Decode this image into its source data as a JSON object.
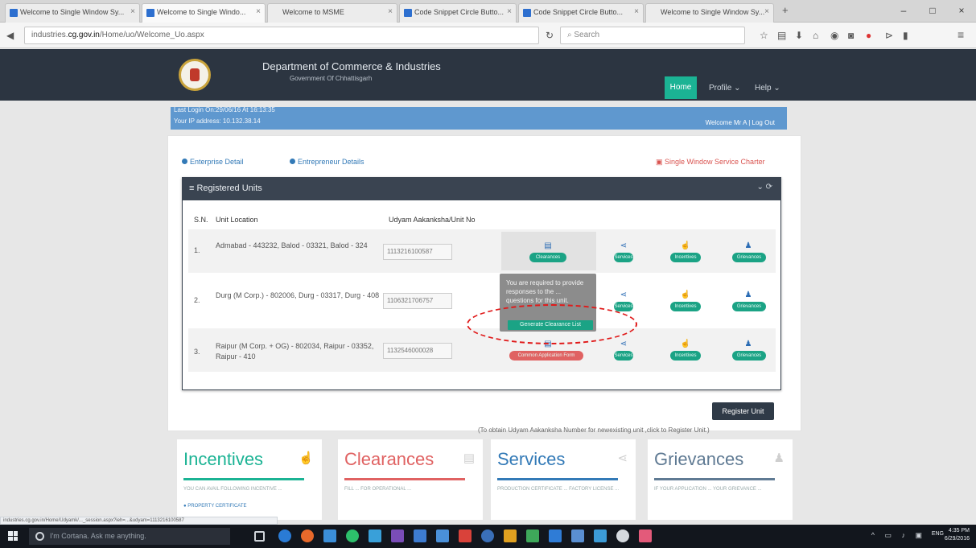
{
  "browser": {
    "tabs": [
      {
        "title": "Welcome to Single Window Sy...",
        "active": false
      },
      {
        "title": "Welcome to Single Windo...",
        "active": true
      },
      {
        "title": "Welcome to MSME",
        "active": false
      },
      {
        "title": "Code Snippet Circle Butto...",
        "active": false
      },
      {
        "title": "Code Snippet Circle Butto...",
        "active": false
      },
      {
        "title": "Welcome to Single Window Sy...",
        "active": false
      }
    ],
    "url_prefix": "industries.",
    "url_domain": "cg.gov.in",
    "url_path": "/Home/uo/Welcome_Uo.aspx",
    "search_placeholder": "Search",
    "new_tab": "+",
    "win_minimize": "–",
    "win_maximize": "□",
    "win_close": "×"
  },
  "site": {
    "department": "Department of Commerce & Industries",
    "government": "Government Of Chhattisgarh",
    "nav": {
      "home": "Home",
      "profile": "Profile ⌄",
      "help": "Help ⌄"
    },
    "last_login": "Last Login On:29/06/16 At 16:13:35",
    "ip_address": "Your IP address: 10.132.38.14",
    "welcome": "Welcome Mr A | Log Out",
    "links": {
      "enterprise": "Enterprise Detail",
      "entrepreneur": "Entrepreneur Details",
      "charter": "Single Window Service Charter"
    }
  },
  "registered_units": {
    "title": "Registered Units",
    "controls": "⌄ ⟳",
    "columns": [
      "S.N.",
      "Unit Location",
      "Udyam Aakanksha/Unit No"
    ],
    "rows": [
      {
        "sn": "1.",
        "location": "Admabad - 443232, Balod - 03321, Balod - 324",
        "udyam": "1113216100587",
        "actions": [
          "Clearances",
          "Services",
          "Incentives",
          "Grievances"
        ]
      },
      {
        "sn": "2.",
        "location": "Durg (M Corp.) - 802006, Durg - 03317, Durg - 408",
        "udyam": "1106321706757",
        "actions": [
          "Clearances",
          "Services",
          "Incentives",
          "Grievances"
        ]
      },
      {
        "sn": "3.",
        "location": "Raipur (M Corp. + OG) - 802034, Raipur - 03352, Raipur - 410",
        "udyam": "1132546000028",
        "actions": [
          "Common Application Form",
          "Services",
          "Incentives",
          "Grievances"
        ]
      }
    ],
    "tooltip_text": "You are required to provide responses to the ... questions for this unit.",
    "tooltip_button": "Generate Clearance List",
    "register_button": "Register Unit",
    "register_note": "(To obtain Udyam Aakanksha Number for newexisting unit ,click to Register Unit.)"
  },
  "bottom_cards": [
    {
      "title": "Incentives",
      "color": "#1bb394",
      "icon": "pointer-icon",
      "text": "YOU CAN AVAIL FOLLOWING INCENTIVE ...",
      "extra": "PROPERTY CERTIFICATE"
    },
    {
      "title": "Clearances",
      "color": "#e06262",
      "icon": "list-icon",
      "text": "FILL ... FOR OPERATIONAL ..."
    },
    {
      "title": "Services",
      "color": "#337ab7",
      "icon": "share-icon",
      "text": "PRODUCTION CERTIFICATE ... FACTORY LICENSE ..."
    },
    {
      "title": "Grievances",
      "color": "#5f7a93",
      "icon": "user-icon",
      "text": "IF YOUR APPLICATION ... YOUR GRIEVANCE ..."
    }
  ],
  "status_url": "industries.cg.gov.in/Home/Udyamk/..._session.aspx?ieh=...&udyam=1113216100587",
  "taskbar": {
    "search_placeholder": "I'm Cortana. Ask me anything.",
    "time": "4:35 PM",
    "date": "6/29/2016",
    "lang": "ENG"
  }
}
